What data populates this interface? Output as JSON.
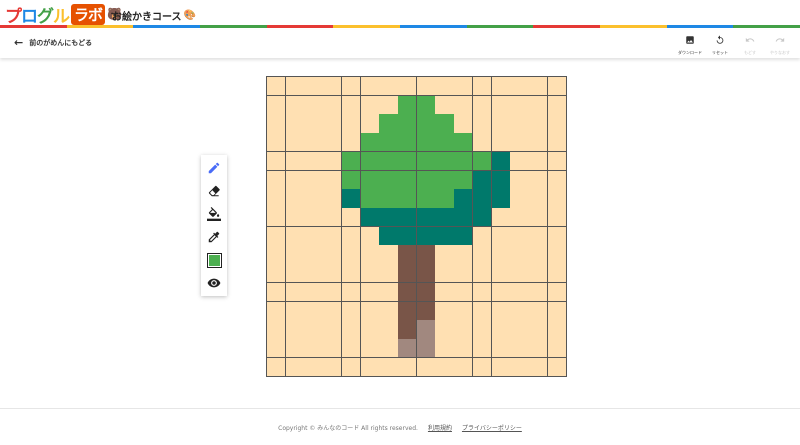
{
  "header": {
    "logo_parts": [
      "プ",
      "ロ",
      "グ",
      "ル"
    ],
    "logo_box": "ラボ",
    "course_title": "お絵かきコース",
    "rainbow_colors": [
      "#e53935",
      "#fbc02d",
      "#1e88e5",
      "#43a047",
      "#e53935",
      "#fbc02d",
      "#1e88e5",
      "#43a047",
      "#e53935",
      "#fbc02d",
      "#1e88e5",
      "#43a047"
    ]
  },
  "toolbar": {
    "back_label": "前のがめんにもどる",
    "actions": [
      {
        "icon": "image-icon",
        "label": "ダウンロード",
        "enabled": true
      },
      {
        "icon": "reset-icon",
        "label": "リセット",
        "enabled": true
      },
      {
        "icon": "undo-icon",
        "label": "もどす",
        "enabled": false
      },
      {
        "icon": "redo-icon",
        "label": "やりなおす",
        "enabled": false
      }
    ]
  },
  "tools": [
    {
      "name": "pencil",
      "icon": "pencil-icon",
      "active": true
    },
    {
      "name": "eraser",
      "icon": "eraser-icon",
      "active": false
    },
    {
      "name": "fill",
      "icon": "paint-bucket-icon",
      "active": false
    },
    {
      "name": "eyedropper",
      "icon": "eyedropper-icon",
      "active": false
    },
    {
      "name": "color",
      "icon": "color-swatch-icon",
      "active": false
    },
    {
      "name": "preview",
      "icon": "eye-icon",
      "active": false
    }
  ],
  "current_color": "#4caf50",
  "colors": {
    "B": "#ffe0b2",
    "G": "#4caf50",
    "T": "#00796b",
    "W": "#795548",
    "L": "#a1887f",
    "accent": "#4a6cf7"
  },
  "pixel_grid": [
    "BBBBBBBBBBBBBBBB",
    "BBBBBBBGGBBBBBBB",
    "BBBBBBGGGGBBBBBB",
    "BBBBBGGGGGGBBBBB",
    "BBBBGGGGGGGGTBBB",
    "BBBBGGGGGGGTTBBB",
    "BBBBTGGGGGTTTBBB",
    "BBBBBTTTTTTTBBBB",
    "BBBBBBTTTTTBBBBB",
    "BBBBBBBWWBBBBBBB",
    "BBBBBBBWWBBBBBBB",
    "BBBBBBBWWBBBBBBB",
    "BBBBBBBWWBBBBBBB",
    "BBBBBBBWLBBBBBBB",
    "BBBBBBBLLBBBBBBB",
    "BBBBBBBBBBBBBBBB"
  ],
  "footer": {
    "copyright": "Copyright © みんなのコード All rights reserved.",
    "terms": "利用規約",
    "privacy": "プライバシーポリシー"
  }
}
